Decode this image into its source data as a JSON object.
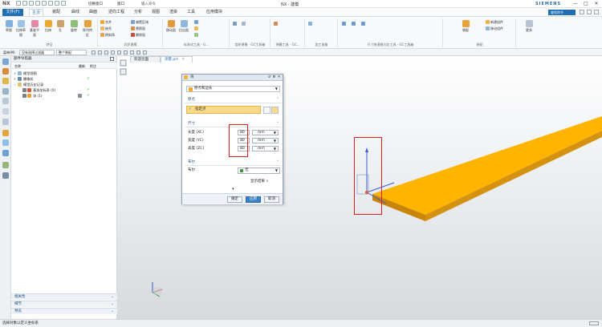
{
  "app": {
    "logo": "NX",
    "title": "NX - 建模",
    "brand": "SIEMENS",
    "window_buttons": [
      "—",
      "□",
      "✕"
    ]
  },
  "quick_access": {
    "switch_window": "切换窗口",
    "window": "窗口",
    "type_filter": "输入命令"
  },
  "menu": {
    "file": "文件(F)",
    "tabs": [
      "主页",
      "装配",
      "曲线",
      "曲面",
      "逆向工程",
      "分析",
      "视图",
      "渲染",
      "工具",
      "应用模块"
    ],
    "active_tab": "主页",
    "search_placeholder": "查找命令"
  },
  "ribbon": {
    "groups": [
      {
        "label": "特征",
        "items": [
          "草图",
          "拉伸草图",
          "基准平面",
          "拉伸",
          "孔",
          "旋转",
          "阵列特征",
          "合并",
          "抽壳",
          "倒斜角"
        ]
      },
      {
        "label": "同步建模",
        "items": [
          "偏置区域",
          "替换面",
          "删除面"
        ]
      },
      {
        "label": "标准化工具 - G...",
        "items": [
          "移动面",
          "拉出面"
        ]
      },
      {
        "label": "齿轮建模 - GC工具箱",
        "items": []
      },
      {
        "label": "弹簧工具 - GC...",
        "items": []
      },
      {
        "label": "加工准备",
        "items": []
      },
      {
        "label": "尺寸快速格式化工具 - GC工具箱",
        "items": []
      },
      {
        "label": "装配",
        "items": [
          "装配",
          "新建组件",
          "移动组件"
        ]
      },
      {
        "label": "更多",
        "items": []
      }
    ]
  },
  "cmdbar": {
    "menu": "菜单(M)",
    "filter": "没有选择过滤器",
    "scope": "整个装配"
  },
  "navigator": {
    "title": "部件导航器",
    "columns": [
      "名称",
      "最新",
      "附注"
    ],
    "rows": [
      {
        "label": "模型视图",
        "level": 1,
        "check": ""
      },
      {
        "label": "摄像机",
        "level": 1,
        "check": "✓"
      },
      {
        "label": "模型历史记录",
        "level": 1,
        "check": ""
      },
      {
        "label": "基准坐标系 (0)",
        "level": 2,
        "check": "✓"
      },
      {
        "label": "块 (1)",
        "level": 2,
        "check": "✓"
      }
    ],
    "sections": [
      "相关性",
      "细节",
      "预览"
    ]
  },
  "doc_tabs": [
    {
      "label": "欢迎页面",
      "active": false
    },
    {
      "label": "测量.prt",
      "active": true
    }
  ],
  "dialog": {
    "title": "块",
    "type_value": "原点和边长",
    "origin_section": "原点",
    "origin_label": "指定点",
    "dims_section": "尺寸",
    "dims": [
      {
        "label": "长度 (XC)",
        "value": "80",
        "unit": "mm"
      },
      {
        "label": "宽度 (YC)",
        "value": "80",
        "unit": "mm"
      },
      {
        "label": "高度 (ZC)",
        "value": "80",
        "unit": "mm"
      }
    ],
    "bool_section": "布尔",
    "bool_label": "布尔",
    "bool_value": "无",
    "preview_label": "显示结果",
    "buttons": {
      "ok": "确定",
      "apply": "应用",
      "cancel": "取消"
    }
  },
  "status": {
    "text": "选择对象以定义坐标系"
  },
  "colors": {
    "accent": "#1f6fb5",
    "highlight": "#fbd98a",
    "part_top": "#ffb400",
    "part_side": "#c7860a",
    "red_marker": "#e02020"
  }
}
